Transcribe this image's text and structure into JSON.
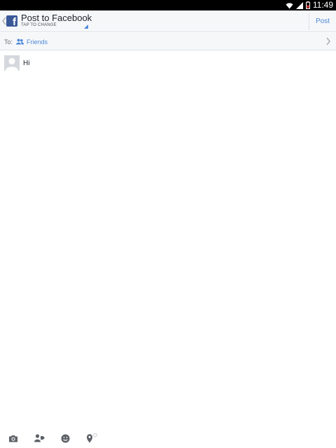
{
  "status_bar": {
    "time": "11:49",
    "icons": [
      "wifi-icon",
      "cellular-signal-icon",
      "battery-icon"
    ]
  },
  "header": {
    "back_icon": "chevron-left-icon",
    "app_icon": "facebook-logo",
    "title": "Post to Facebook",
    "subtitle": "TAP TO CHANGE",
    "post_label": "Post"
  },
  "audience": {
    "to_label": "To:",
    "icon": "friends-icon",
    "value": "Friends"
  },
  "composer": {
    "avatar": "profile-placeholder",
    "text": "Hi"
  },
  "toolbar": {
    "items": [
      "camera-icon",
      "tag-people-icon",
      "emoji-icon",
      "location-icon"
    ]
  },
  "colors": {
    "accent": "#4b88d8",
    "facebook_blue": "#3b5998",
    "header_bg": "#f6f7f9",
    "icon_gray": "#5d6167"
  }
}
